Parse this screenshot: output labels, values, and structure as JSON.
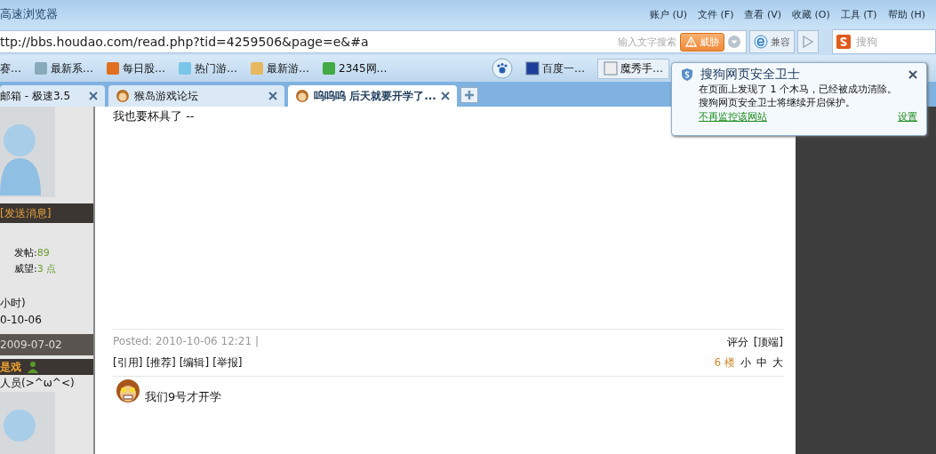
{
  "window": {
    "title": "高速浏览器"
  },
  "menu": [
    "账户 (U)",
    "文件 (F)",
    "查看 (V)",
    "收藏 (O)",
    "工具 (T)",
    "帮助 (H)"
  ],
  "address_bar": {
    "url": "ttp://bbs.houdao.com/read.php?tid=4259506&page=e&#a",
    "search_placeholder": "输入文字搜索",
    "threat_button": "威胁",
    "compat_button": "兼容"
  },
  "search_box": {
    "placeholder": "搜狗"
  },
  "bookmarks": [
    "赛…",
    "最新系…",
    "每日股…",
    "热门游…",
    "最新游…",
    "2345网…"
  ],
  "bookmarks_right": [
    "百度一…",
    "魔秀手…"
  ],
  "tabs": [
    {
      "label": "邮箱 - 极速3.5",
      "selected": false
    },
    {
      "label": "猴岛游戏论坛",
      "selected": false
    },
    {
      "label": "呜呜呜 后天就要开学了...",
      "selected": true
    }
  ],
  "popup": {
    "title": "搜狗网页安全卫士",
    "lines": [
      "在页面上发现了 1 个木马，已经被成功清除。",
      "搜狗网页安全卫士将继续开启保护。"
    ],
    "link": "不再监控该网站",
    "settings": "设置"
  },
  "sidebar": {
    "send_message": "[发送消息]",
    "stats": [
      {
        "label": "发帖:",
        "value": "89"
      },
      {
        "label": "威望:",
        "value": "3 点"
      }
    ],
    "online": "小时)",
    "last_date": "0-10-06",
    "reg_date": "2009-07-02",
    "next_user": "是戏",
    "next_title": "人员(>^ω^<)"
  },
  "post": {
    "body": "我也要杯具了 --",
    "posted": "Posted: 2010-10-06 12:21 |",
    "rate": "评分",
    "top": "[顶端]",
    "actions": [
      "[引用]",
      "[推荐]",
      "[编辑]",
      "[举报]"
    ],
    "floor": "6 楼",
    "sizes": [
      "小",
      "中",
      "大"
    ]
  },
  "reply": {
    "text": "我们9号才开学"
  }
}
